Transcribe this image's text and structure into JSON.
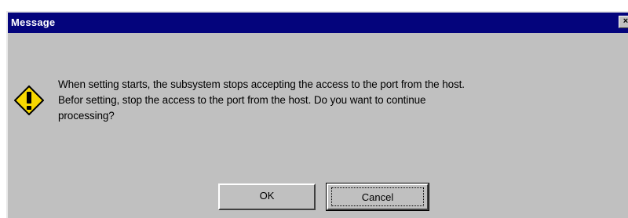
{
  "window": {
    "title": "Message",
    "close_glyph": "×"
  },
  "message": {
    "icon": "warning-exclamation-icon",
    "lines": [
      "When setting starts, the subsystem stops accepting the access to the port from the host.",
      "Befor setting, stop the access to the port from the host. Do you want to continue",
      "processing?"
    ]
  },
  "buttons": {
    "ok_label": "OK",
    "cancel_label": "Cancel"
  },
  "colors": {
    "titlebar": "#04047c",
    "dialog_bg": "#c0c0c0",
    "icon_fill": "#f8d800"
  }
}
